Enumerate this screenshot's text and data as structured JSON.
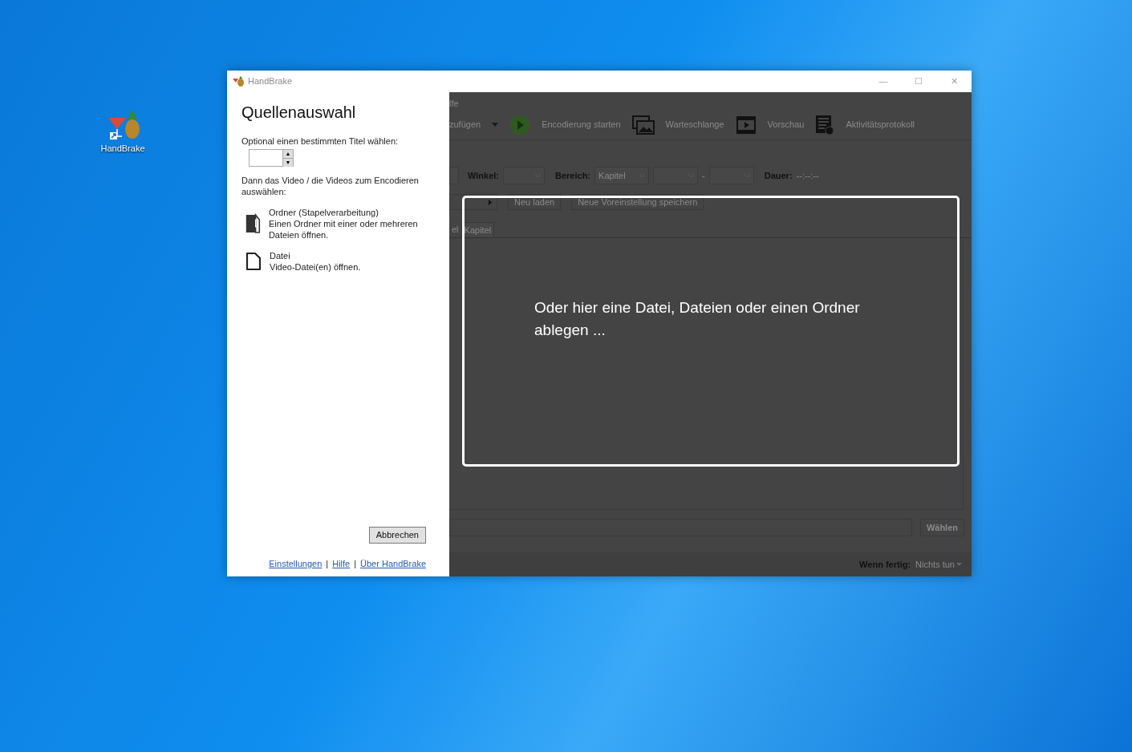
{
  "desktop": {
    "icons": [
      {
        "label": "HandBrake"
      }
    ]
  },
  "window": {
    "title": "HandBrake",
    "controls": [
      "—",
      "☐",
      "✕"
    ]
  },
  "dialog": {
    "heading": "Quellenauswahl",
    "title_prompt": "Optional einen bestimmten Titel wählen:",
    "spinner": {
      "up": "▲",
      "down": "▼"
    },
    "video_prompt": "Dann das Video / die Videos zum Encodieren auswählen:",
    "options": [
      {
        "kind": "folder",
        "title": "Ordner (Stapelverarbeitung)",
        "description": "Einen Ordner mit einer oder mehreren Dateien öffnen."
      },
      {
        "kind": "file",
        "title": "Datei",
        "description": "Video-Datei(en) öffnen."
      }
    ],
    "cancel": "Abbrechen",
    "links": [
      "Einstellungen",
      "Hilfe",
      "Über HandBrake"
    ],
    "separator": "|"
  },
  "background_app": {
    "menu": "lfe",
    "toolbar": [
      {
        "kind": "dropdown",
        "label": "zufügen"
      },
      {
        "kind": "play",
        "label": "Encodierung starten"
      },
      {
        "kind": "queue",
        "label": "Warteschlange"
      },
      {
        "kind": "film",
        "label": "Vorschau"
      },
      {
        "kind": "log",
        "label": "Aktivitätsprotokoll"
      }
    ],
    "source_row": {
      "angle_label": "Winkel:",
      "range_label": "Bereich:",
      "range_value": "Kapitel",
      "dash": "-",
      "duration_label": "Dauer:",
      "duration_value": "--:--:--"
    },
    "preset_row": {
      "buttons": [
        "Neu laden",
        "Neue Voreinstellung speichern"
      ]
    },
    "tabs": [
      {
        "label": "el",
        "selected": false
      },
      {
        "label": "Kapitel",
        "selected": true
      }
    ],
    "choose_button": "Wählen",
    "when_done_label": "Wenn fertig:",
    "when_done_value": "Nichts tun"
  },
  "drop_zone": {
    "text": "Oder hier eine Datei, Dateien oder einen Ordner ablegen ..."
  }
}
